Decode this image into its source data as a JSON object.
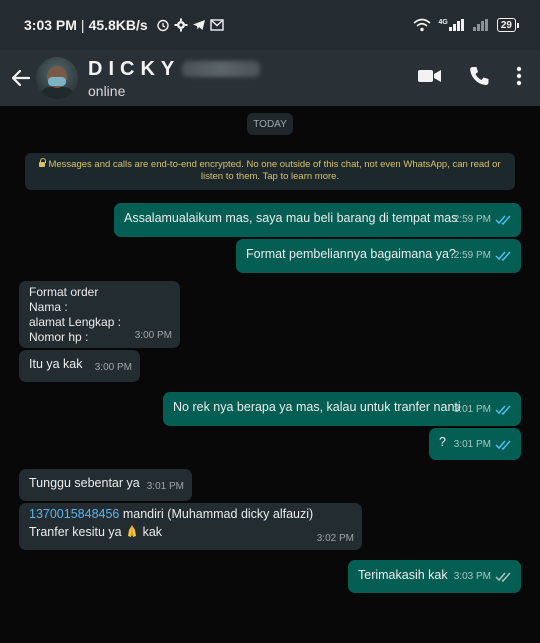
{
  "status_bar": {
    "time": "3:03 PM",
    "speed": "45.8KB/s",
    "battery": "29",
    "network": "4G"
  },
  "header": {
    "contact_name": "DICKY",
    "contact_status": "online",
    "icons": [
      "back-arrow-icon",
      "avatar",
      "video-call-icon",
      "voice-call-icon",
      "more-options-icon"
    ]
  },
  "chat": {
    "date_chip": "TODAY",
    "encryption_notice": "Messages and calls are end-to-end encrypted. No one outside of this chat, not even WhatsApp, can read or listen to them. Tap to learn more.",
    "messages": [
      {
        "direction": "out",
        "text": "Assalamualaikum mas, saya mau beli barang di tempat mas",
        "time": "2:59 PM",
        "read": true
      },
      {
        "direction": "out",
        "text": "Format pembeliannya bagaimana ya?",
        "time": "2:59 PM",
        "read": true
      },
      {
        "direction": "in",
        "text": "Format order\nNama :\nalamat Lengkap :\nNomor hp :",
        "time": "3:00 PM"
      },
      {
        "direction": "in",
        "text": "Itu ya kak",
        "time": "3:00 PM"
      },
      {
        "direction": "out",
        "text": "No rek nya berapa ya mas, kalau untuk tranfer nanti",
        "time": "3:01 PM",
        "read": true
      },
      {
        "direction": "out",
        "text": "?",
        "time": "3:01 PM",
        "read": true
      },
      {
        "direction": "in",
        "text": "Tunggu sebentar ya",
        "time": "3:01 PM"
      },
      {
        "direction": "in",
        "link": "1370015848456",
        "text_after_link": " mandiri (Muhammad dicky alfauzi)",
        "line2_before": "Tranfer kesitu ya",
        "emoji": "folded-hands-emoji",
        "line2_after": " kak",
        "time": "3:02 PM"
      },
      {
        "direction": "out",
        "text": "Terimakasih kak",
        "time": "3:03 PM",
        "read": true
      }
    ]
  },
  "colors": {
    "outgoing_bubble": "#055e54",
    "incoming_bubble": "#232c31",
    "read_ticks": "#53bdeb",
    "header_bg": "#2a3136"
  }
}
